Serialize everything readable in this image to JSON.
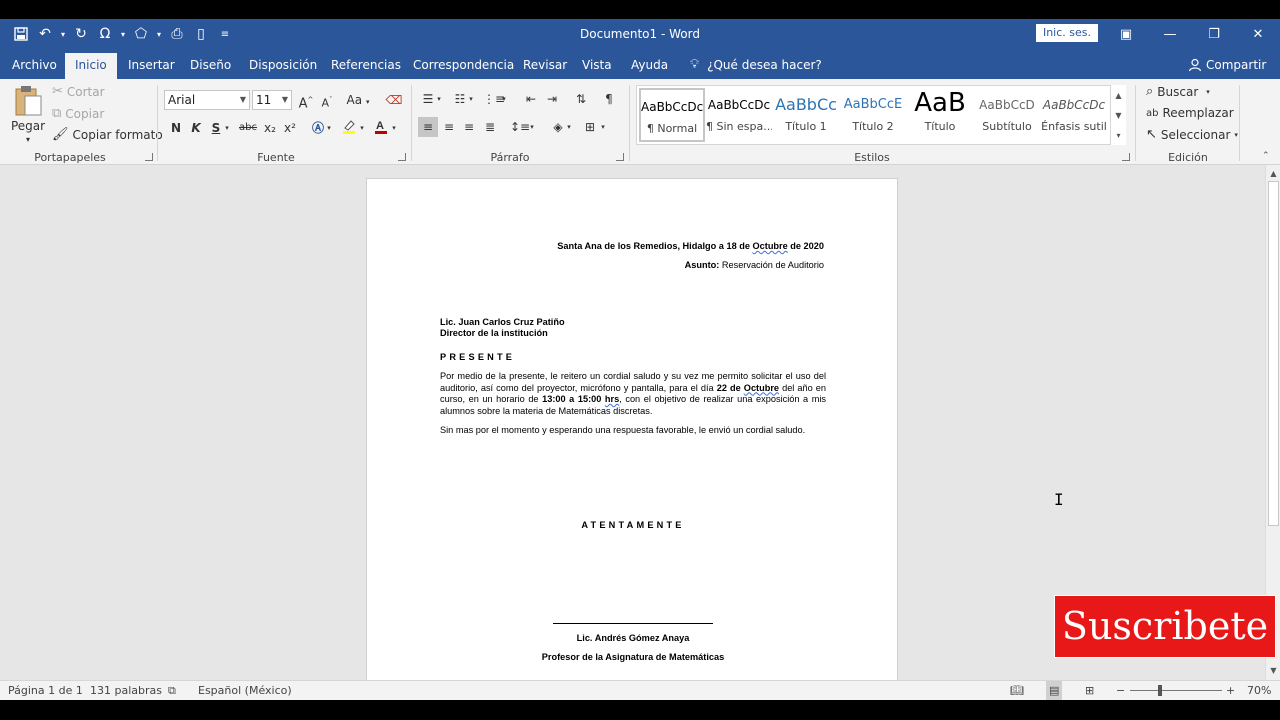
{
  "window": {
    "title": "Documento1 - Word",
    "signin_label": "Inic. ses."
  },
  "tabs": [
    "Archivo",
    "Inicio",
    "Insertar",
    "Diseño",
    "Disposición",
    "Referencias",
    "Correspondencia",
    "Revisar",
    "Vista",
    "Ayuda"
  ],
  "active_tab": "Inicio",
  "tellme_label": "¿Qué desea hacer?",
  "share_label": "Compartir",
  "clipboard": {
    "paste_label": "Pegar",
    "cut_label": "Cortar",
    "copy_label": "Copiar",
    "format_painter_label": "Copiar formato",
    "group_label": "Portapapeles"
  },
  "font": {
    "font_name": "Arial",
    "font_size": "11",
    "group_label": "Fuente",
    "bold": "N",
    "italic": "K",
    "underline": "S",
    "strike": "abc",
    "subscript": "x₂",
    "superscript": "x²",
    "case": "Aa",
    "grow": "A",
    "shrink": "A"
  },
  "paragraph": {
    "group_label": "Párrafo"
  },
  "styles": {
    "group_label": "Estilos",
    "items": [
      {
        "sample": "AaBbCcDc",
        "name": "¶ Normal"
      },
      {
        "sample": "AaBbCcDc",
        "name": "¶ Sin espa..."
      },
      {
        "sample": "AaBbCc",
        "name": "Título 1"
      },
      {
        "sample": "AaBbCcE",
        "name": "Título 2"
      },
      {
        "sample": "AaB",
        "name": "Título"
      },
      {
        "sample": "AaBbCcD",
        "name": "Subtítulo"
      },
      {
        "sample": "AaBbCcDc",
        "name": "Énfasis sutil"
      }
    ]
  },
  "editing": {
    "find_label": "Buscar",
    "replace_label": "Reemplazar",
    "select_label": "Seleccionar",
    "group_label": "Edición"
  },
  "document": {
    "date_prefix": "Santa Ana de los Remedios, Hidalgo a 18 de ",
    "date_month": "Octubre",
    "date_suffix": " de 2020",
    "subject_label": "Asunto:",
    "subject_value": " Reservación de Auditorio",
    "recipient_name": "Lic. Juan Carlos Cruz Patiño",
    "recipient_title": "Director de la institución",
    "greeting": "PRESENTE",
    "body_1a": "Por medio de la presente, le reitero un cordial saludo y su vez me permito solicitar el uso del auditorio, así como del proyector, micrófono y pantalla, para el día ",
    "body_1b": "22 de ",
    "body_1c": "Octubre",
    "body_1d": " del año en curso, en un horario de ",
    "body_1e": "13:00 a 15:00 ",
    "body_1f": "hrs",
    "body_1g": ", con el objetivo de realizar una exposición a mis alumnos sobre la materia de Matemáticas discretas.",
    "body_2": "Sin mas por el momento y esperando una respuesta favorable, le envió un cordial saludo.",
    "closing": "ATENTAMENTE",
    "signer_name": "Lic. Andrés Gómez Anaya",
    "signer_title": "Profesor de la Asignatura de Matemáticas"
  },
  "overlay": {
    "subscribe_text": "Suscribete"
  },
  "status": {
    "page": "Página 1 de 1",
    "words": "131 palabras",
    "language": "Español (México)",
    "zoom": "70%"
  },
  "colors": {
    "accent": "#2b579a",
    "subscribe_bg": "#e81818"
  }
}
